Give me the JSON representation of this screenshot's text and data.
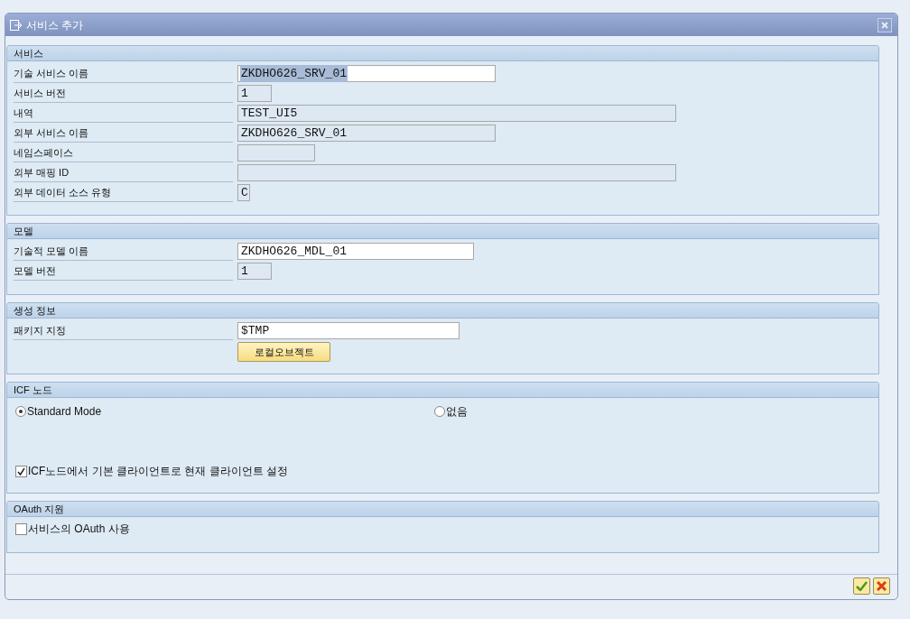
{
  "window": {
    "title": "서비스 추가"
  },
  "sections": [
    {
      "title": "서비스",
      "items": [
        {
          "kind": "field",
          "label": "기술 서비스 이름",
          "value": "ZKDHO626_SRV_01",
          "editable": true,
          "highlighted": true
        },
        {
          "kind": "field",
          "label": "서비스 버전",
          "value": "1",
          "editable": false
        },
        {
          "kind": "field",
          "label": "내역",
          "value": "TEST_UI5",
          "editable": false
        },
        {
          "kind": "field",
          "label": "외부 서비스 이름",
          "value": "ZKDHO626_SRV_01",
          "editable": false
        },
        {
          "kind": "field",
          "label": "네임스페이스",
          "editable": false
        },
        {
          "kind": "field",
          "label": "외부 매핑 ID",
          "editable": false
        },
        {
          "kind": "field",
          "label": "외부 데이터 소스 유형",
          "value": "C",
          "editable": false
        }
      ]
    },
    {
      "title": "모델",
      "items": [
        {
          "kind": "field",
          "label": "기술적 모델 이름",
          "value": "ZKDHO626_MDL_01",
          "editable": true
        },
        {
          "kind": "field",
          "label": "모델 버전",
          "value": "1",
          "editable": false
        }
      ]
    },
    {
      "title": "생성 정보",
      "items": [
        {
          "kind": "field",
          "label": "패키지 지정",
          "value": "$TMP",
          "editable": true
        },
        {
          "kind": "button",
          "label": "로컬오브젝트"
        }
      ]
    },
    {
      "title": "ICF 노드",
      "items": [
        {
          "kind": "radios",
          "options": [
            {
              "label": "Standard Mode",
              "selected": true
            },
            {
              "label": "없음",
              "selected": false
            }
          ]
        },
        {
          "kind": "checkbox",
          "label": "ICF노드에서 기본 클라이언트로 현재 클라이언트 설정",
          "checked": true
        }
      ]
    },
    {
      "title": "OAuth 지원",
      "items": [
        {
          "kind": "checkbox",
          "label": "서비스의 OAuth 사용",
          "checked": false
        }
      ]
    }
  ]
}
